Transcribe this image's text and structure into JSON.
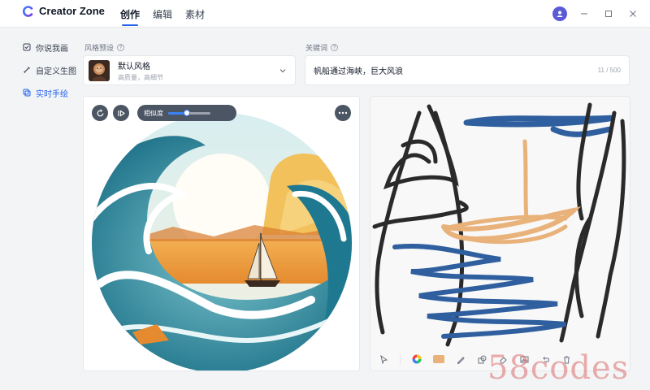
{
  "app": {
    "brand_name": "Creator Zone"
  },
  "header": {
    "tabs": [
      {
        "label": "创作",
        "active": true
      },
      {
        "label": "编辑",
        "active": false
      },
      {
        "label": "素材",
        "active": false
      }
    ]
  },
  "sidebar": {
    "items": [
      {
        "label": "你说我画",
        "icon": "chat-image-icon",
        "active": false
      },
      {
        "label": "自定义生图",
        "icon": "brush-icon",
        "active": false
      },
      {
        "label": "实时手绘",
        "icon": "layers-icon",
        "active": true
      }
    ]
  },
  "style_preset": {
    "label": "风格预设",
    "selected_name": "默认风格",
    "selected_desc": "高质量，高细节"
  },
  "keywords": {
    "label": "关键词",
    "value": "帆船通过海峡，巨大风浪",
    "counter": "11 / 500"
  },
  "image_controls": {
    "similarity_label": "相似度",
    "similarity_value": 0.45
  },
  "colors": {
    "accent": "#2563eb",
    "brush_color": "#e8b27a"
  },
  "watermark": "58codes"
}
